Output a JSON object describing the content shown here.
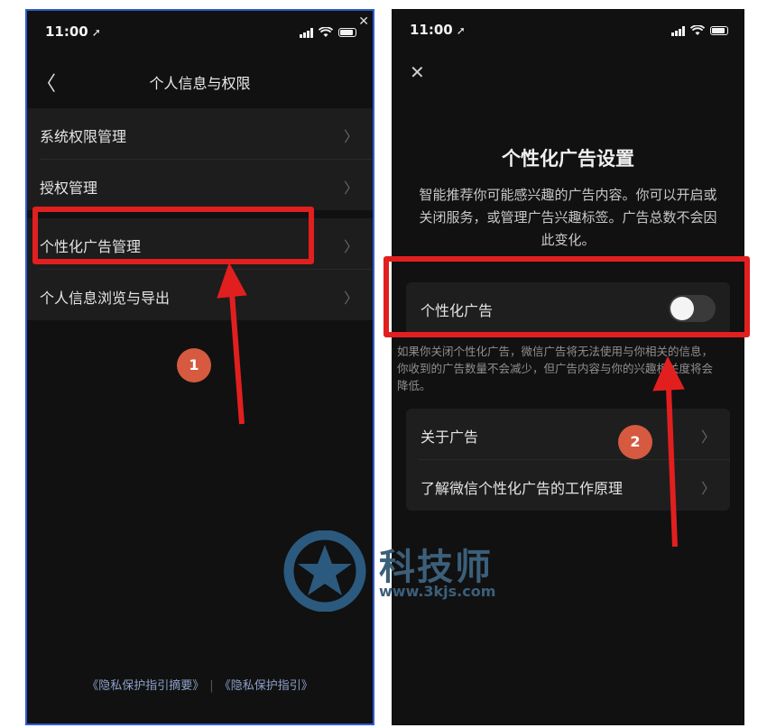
{
  "left_phone": {
    "status": {
      "time": "11:00",
      "loc_glyph": "➚",
      "close_glyph": "✕"
    },
    "nav": {
      "back_glyph": "〈",
      "title": "个人信息与权限"
    },
    "items": [
      {
        "label": "系统权限管理"
      },
      {
        "label": "授权管理"
      },
      {
        "label": "个性化广告管理"
      },
      {
        "label": "个人信息浏览与导出"
      }
    ],
    "chevron": "〉",
    "footer": {
      "link1": "《隐私保护指引摘要》",
      "separator": "|",
      "link2": "《隐私保护指引》"
    }
  },
  "right_phone": {
    "status": {
      "time": "11:00",
      "loc_glyph": "➚"
    },
    "close_glyph": "✕",
    "title": "个性化广告设置",
    "description": "智能推荐你可能感兴趣的广告内容。你可以开启或关闭服务，或管理广告兴趣标签。广告总数不会因此变化。",
    "toggle": {
      "label": "个性化广告",
      "state": "off"
    },
    "note": "如果你关闭个性化广告，微信广告将无法使用与你相关的信息，你收到的广告数量不会减少，但广告内容与你的兴趣相关度将会降低。",
    "items": [
      {
        "label": "关于广告"
      },
      {
        "label": "了解微信个性化广告的工作原理"
      }
    ],
    "chevron": "〉"
  },
  "annotations": {
    "step1": "1",
    "step2": "2",
    "highlight_color": "#e21f1f",
    "badge_color": "#d55a40"
  },
  "watermark": {
    "text": "科技师",
    "url": "www.3kjs.com"
  }
}
